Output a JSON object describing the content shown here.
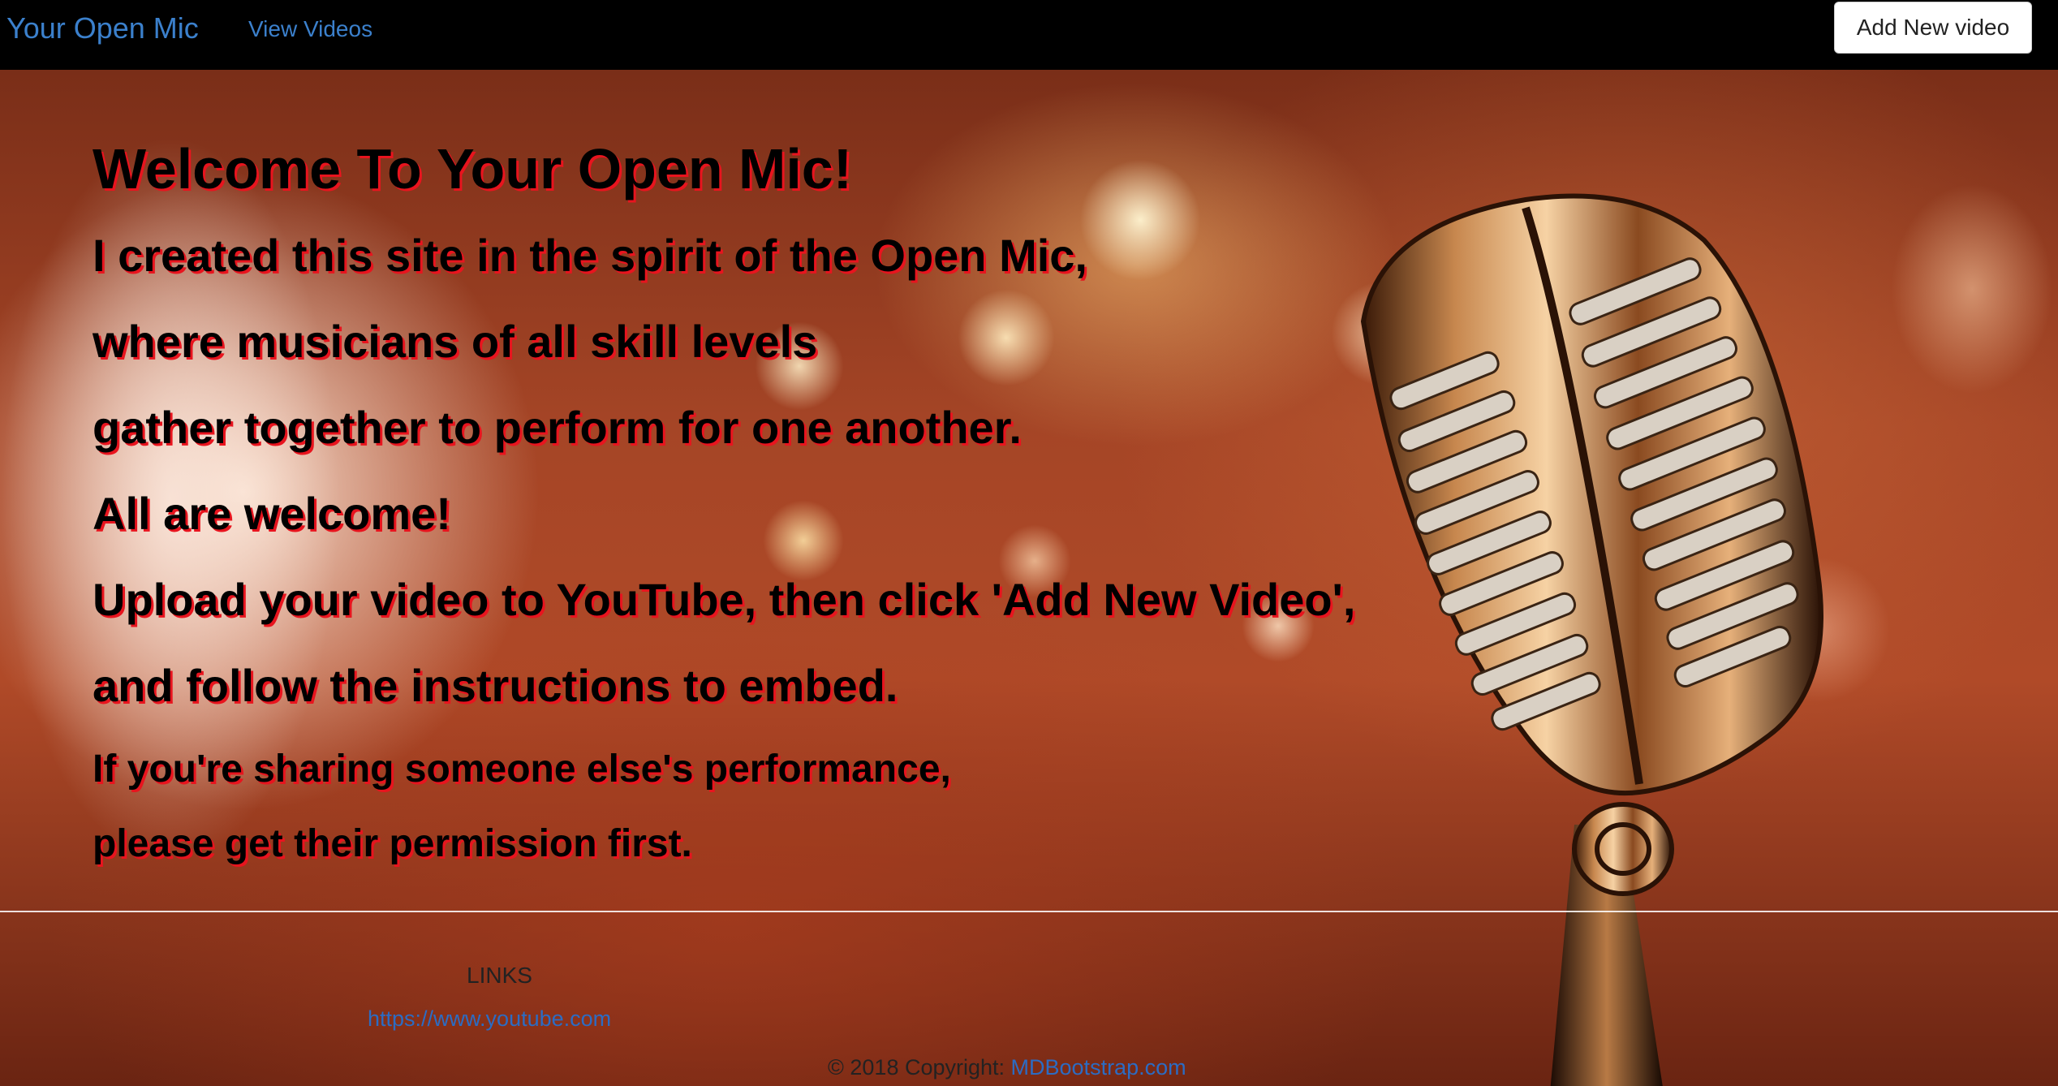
{
  "navbar": {
    "brand": "Your Open Mic",
    "view_videos": "View Videos",
    "add_button": "Add New video"
  },
  "hero": {
    "welcome": "Welcome To Your Open Mic!",
    "lines": [
      "I created this site in the spirit of the Open Mic,",
      "where musicians of all skill levels",
      "gather together to perform for one another.",
      "All are welcome!",
      "Upload your video to YouTube, then click 'Add New Video',",
      "and follow the instructions to embed.",
      "If you're sharing someone else's performance,",
      "please get their permission first."
    ]
  },
  "footer": {
    "links_title": "LINKS",
    "youtube_link": "https://www.youtube.com",
    "copyright_prefix": "© 2018 Copyright: ",
    "copyright_link": "MDBootstrap.com"
  },
  "colors": {
    "navbar_bg": "#000000",
    "link": "#3b80cc",
    "text_shadow": "#e8141e"
  },
  "icons": [
    "microphone-illustration"
  ]
}
